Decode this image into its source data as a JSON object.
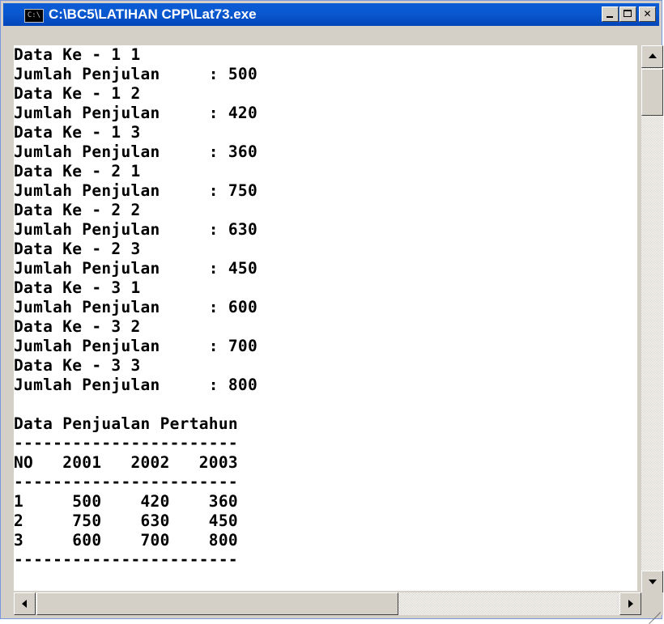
{
  "window": {
    "title": "C:\\BC5\\LATIHAN CPP\\Lat73.exe",
    "icon_text": "C:\\"
  },
  "console": {
    "lines": [
      "Data Ke - 1 1",
      "Jumlah Penjulan     : 500",
      "Data Ke - 1 2",
      "Jumlah Penjulan     : 420",
      "Data Ke - 1 3",
      "Jumlah Penjulan     : 360",
      "Data Ke - 2 1",
      "Jumlah Penjulan     : 750",
      "Data Ke - 2 2",
      "Jumlah Penjulan     : 630",
      "Data Ke - 2 3",
      "Jumlah Penjulan     : 450",
      "Data Ke - 3 1",
      "Jumlah Penjulan     : 600",
      "Data Ke - 3 2",
      "Jumlah Penjulan     : 700",
      "Data Ke - 3 3",
      "Jumlah Penjulan     : 800",
      "",
      "Data Penjualan Pertahun",
      "-----------------------",
      "NO   2001   2002   2003",
      "-----------------------",
      "1     500    420    360",
      "2     750    630    450",
      "3     600    700    800",
      "-----------------------"
    ]
  },
  "colors": {
    "titlebar": "#0a58d0",
    "console_bg": "#ffffff",
    "console_text": "#000000",
    "chrome": "#d4d0c8"
  },
  "icons": {
    "app": "console-icon",
    "minimize": "minimize-icon",
    "maximize": "maximize-icon",
    "close": "close-icon"
  }
}
